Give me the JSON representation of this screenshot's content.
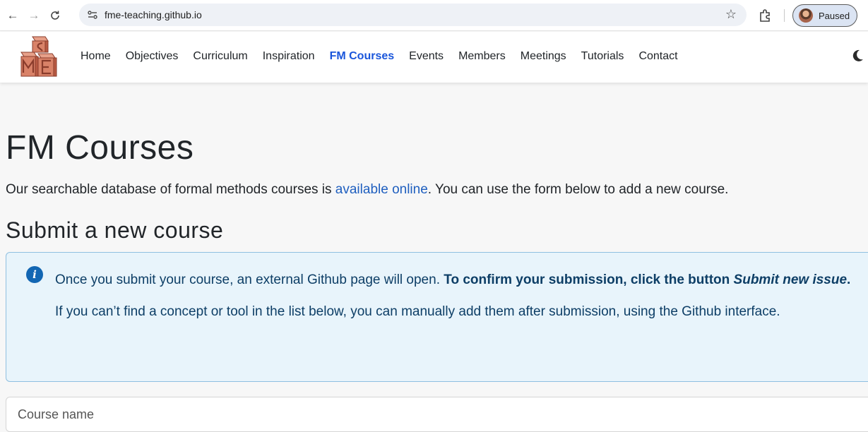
{
  "browser": {
    "url": "fme-teaching.github.io",
    "profile_label": "Paused"
  },
  "nav": {
    "items": [
      {
        "label": "Home"
      },
      {
        "label": "Objectives"
      },
      {
        "label": "Curriculum"
      },
      {
        "label": "Inspiration"
      },
      {
        "label": "FM Courses",
        "active": true
      },
      {
        "label": "Events"
      },
      {
        "label": "Members"
      },
      {
        "label": "Meetings"
      },
      {
        "label": "Tutorials"
      },
      {
        "label": "Contact"
      }
    ]
  },
  "page": {
    "title": "FM Courses",
    "intro_before": "Our searchable database of formal methods courses is ",
    "intro_link": "available online",
    "intro_after": ". You can use the form below to add a new course.",
    "subtitle": "Submit a new course"
  },
  "info": {
    "line1_plain": "Once you submit your course, an external Github page will open. ",
    "line1_bold": "To confirm your submission, click the button ",
    "line1_bold_italic": "Submit new issue",
    "line1_end": ".",
    "line2": "If you can’t find a concept or tool in the list below, you can manually add them after submission, using the Github interface."
  },
  "form": {
    "course_name_placeholder": "Course name"
  },
  "colors": {
    "accent": "#1a56db",
    "link": "#1f5fbf",
    "info_bg": "#e8f4fb",
    "info_border": "#8fbfe0",
    "info_text": "#0d3e66"
  }
}
